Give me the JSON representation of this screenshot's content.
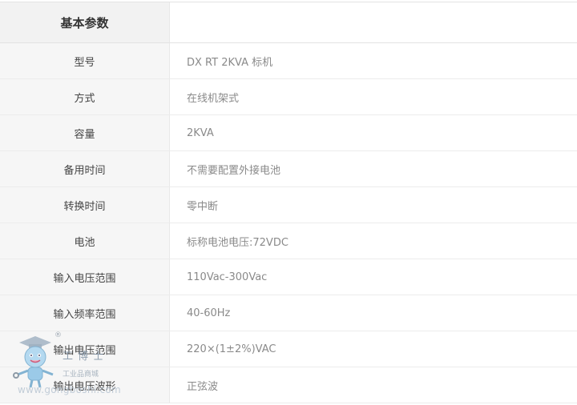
{
  "table": {
    "header": {
      "label": "基本参数",
      "value": ""
    },
    "rows": [
      {
        "label": "型号",
        "value": "DX RT 2KVA 标机"
      },
      {
        "label": "方式",
        "value": "在线机架式"
      },
      {
        "label": "容量",
        "value": "2KVA"
      },
      {
        "label": "备用时间",
        "value": "不需要配置外接电池"
      },
      {
        "label": "转换时间",
        "value": "零中断"
      },
      {
        "label": "电池",
        "value": "标称电池电压:72VDC"
      },
      {
        "label": "输入电压范围",
        "value": "110Vac-300Vac"
      },
      {
        "label": "输入频率范围",
        "value": "40-60Hz"
      },
      {
        "label": "输出电压范围",
        "value": "220×(1±2%)VAC"
      },
      {
        "label": "输出电压波形",
        "value": "正弦波"
      }
    ]
  },
  "watermark": {
    "brand": "工博士",
    "tagline": "工业品商城",
    "site": "www.gongboshi.com",
    "registered": "®"
  }
}
